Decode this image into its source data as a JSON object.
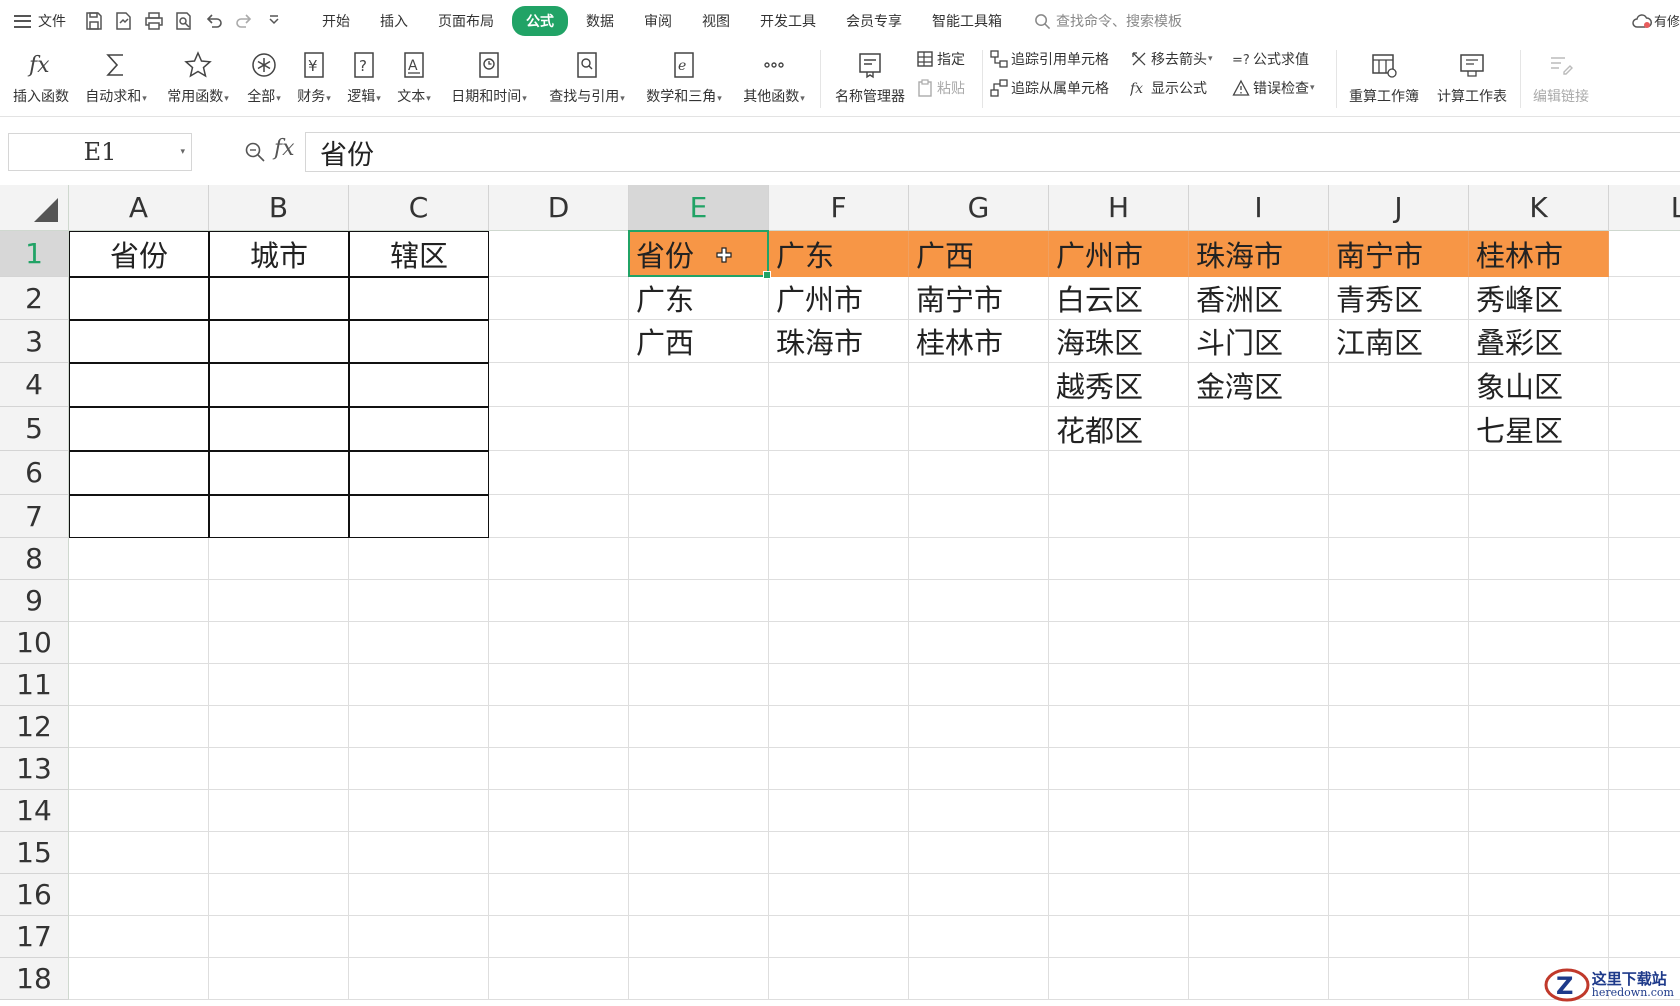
{
  "menubar": {
    "file_label": "文件",
    "quick_icons": [
      "save-icon",
      "export-icon",
      "print-icon",
      "print-preview-icon",
      "undo-icon",
      "redo-icon",
      "customize-icon"
    ],
    "tabs": [
      "开始",
      "插入",
      "页面布局",
      "公式",
      "数据",
      "审阅",
      "视图",
      "开发工具",
      "会员专享",
      "智能工具箱"
    ],
    "active_tab": "公式",
    "search_placeholder": "查找命令、搜索模板",
    "share_label": "有修"
  },
  "ribbon": {
    "insert_function": "插入函数",
    "autosum": "自动求和",
    "common_functions": "常用函数",
    "all": "全部",
    "finance": "财务",
    "logic": "逻辑",
    "text": "文本",
    "datetime": "日期和时间",
    "lookup": "查找与引用",
    "math": "数学和三角",
    "other_functions": "其他函数",
    "name_manager": "名称管理器",
    "specify": "指定",
    "paste": "粘贴",
    "trace_precedents": "追踪引用单元格",
    "trace_dependents": "追踪从属单元格",
    "remove_arrows": "移去箭头",
    "show_formulas": "显示公式",
    "evaluate_formula": "公式求值",
    "error_check": "错误检查",
    "recalc_workbook": "重算工作簿",
    "calc_sheet": "计算工作表",
    "edit_links": "编辑链接"
  },
  "formulabar": {
    "name_box": "E1",
    "fx": "fx",
    "value": "省份"
  },
  "sheet": {
    "columns": [
      "A",
      "B",
      "C",
      "D",
      "E",
      "F",
      "G",
      "H",
      "I",
      "J",
      "K",
      "L"
    ],
    "rows": [
      "1",
      "2",
      "3",
      "4",
      "5",
      "6",
      "7",
      "8",
      "9",
      "10",
      "11",
      "12",
      "13",
      "14",
      "15",
      "16",
      "17",
      "18"
    ],
    "selected_cell": "E1",
    "header_table": [
      "省份",
      "城市",
      "辖区"
    ],
    "source_rows": [
      [
        "省份",
        "广东",
        "广西",
        "广州市",
        "珠海市",
        "南宁市",
        "桂林市"
      ],
      [
        "广东",
        "广州市",
        "南宁市",
        "白云区",
        "香洲区",
        "青秀区",
        "秀峰区"
      ],
      [
        "广西",
        "珠海市",
        "桂林市",
        "海珠区",
        "斗门区",
        "江南区",
        "叠彩区"
      ],
      [
        "",
        "",
        "",
        "越秀区",
        "金湾区",
        "",
        "象山区"
      ],
      [
        "",
        "",
        "",
        "花都区",
        "",
        "",
        "七星区"
      ]
    ],
    "header_fill_color": "#f79646",
    "accent_color": "#21a366"
  },
  "watermark": {
    "title": "这里下载站",
    "url": "heredown.com"
  }
}
